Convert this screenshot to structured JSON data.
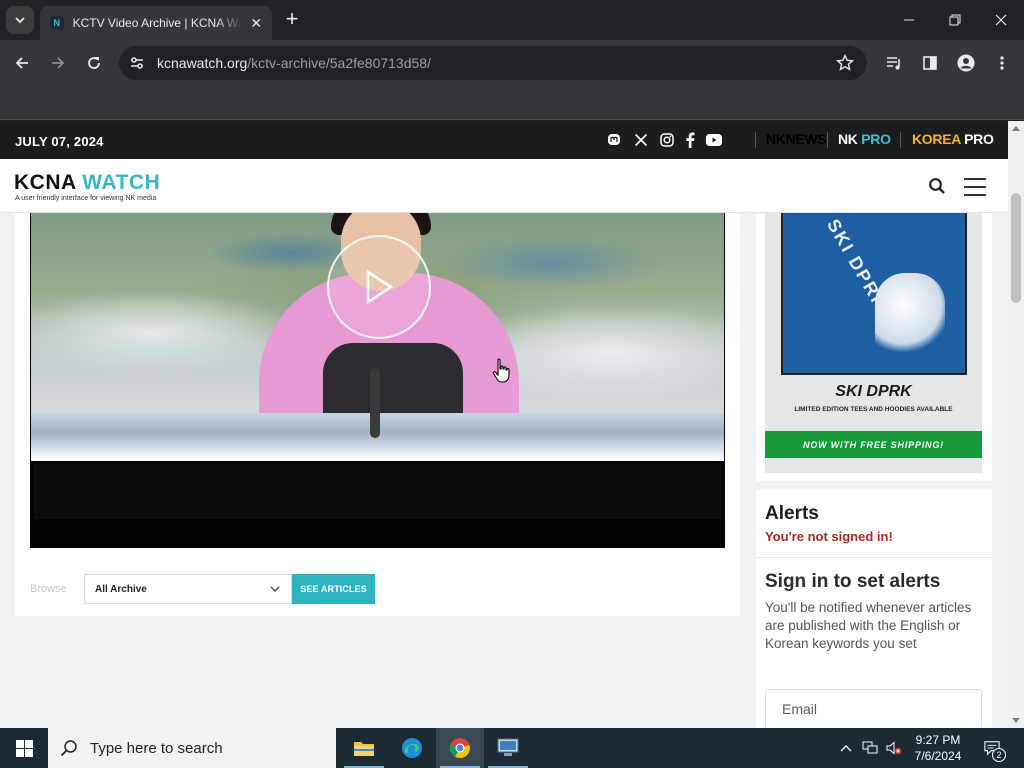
{
  "browser": {
    "tab_title": "KCTV Video Archive | KCNA Watch",
    "tab_favicon_letter": "N",
    "new_tab_symbol": "+",
    "tab_close_symbol": "✕",
    "url_domain": "kcnawatch.org",
    "url_path": "/kctv-archive/5a2fe80713d58/"
  },
  "site": {
    "date": "JULY 07, 2024",
    "brands": [
      {
        "part1": "NK",
        "part2": "NEWS",
        "color1": "#ffffff",
        "color2": "#ffffff"
      },
      {
        "part1": "NK ",
        "part2": "PRO",
        "color1": "#ffffff",
        "color2": "#3cc3d3"
      },
      {
        "part1": "KOREA ",
        "part2": "PRO",
        "color1": "#f4b41a",
        "color2": "#ffffff"
      }
    ],
    "logo_part1": "KCNA ",
    "logo_part2": "WATCH",
    "logo_tagline": "A user friendly interface for viewing NK media",
    "accent_color": "#38b8c4"
  },
  "browse": {
    "label": "Browse",
    "select_value": "All Archive",
    "button_label": "SEE ARTICLES"
  },
  "ad": {
    "shirt_text": "SKI DPRK",
    "title": "SKI DPRK",
    "subtitle": "LIMITED EDITION TEES AND HOODIES AVAILABLE",
    "cta": "NOW WITH FREE SHIPPING!"
  },
  "alerts": {
    "title": "Alerts",
    "status": "You're not signed in!",
    "signin_heading": "Sign in to set alerts",
    "description": "You'll be notified whenever articles are published with the English or Korean keywords you set",
    "email_placeholder": "Email"
  },
  "taskbar": {
    "search_placeholder": "Type here to search",
    "time": "9:27 PM",
    "date": "7/6/2024",
    "notification_count": "2"
  }
}
